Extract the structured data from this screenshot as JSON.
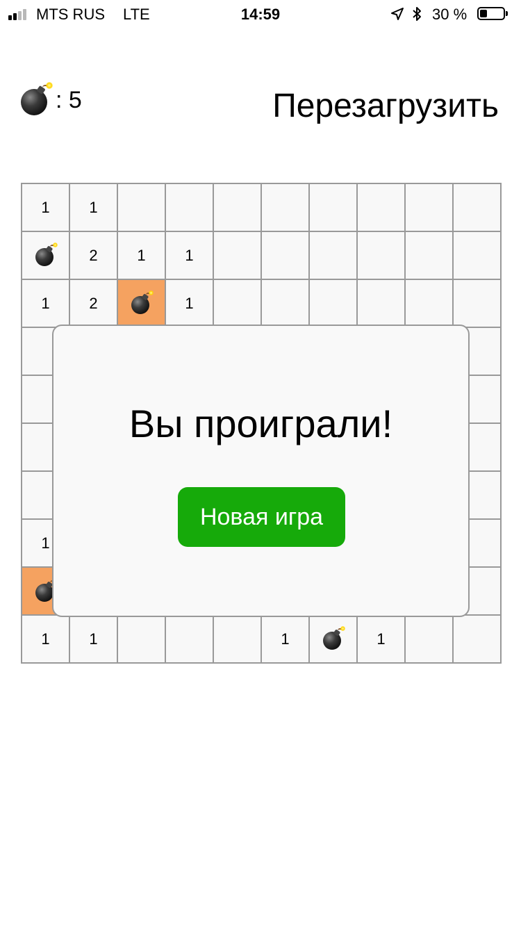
{
  "status_bar": {
    "carrier": "MTS RUS",
    "network": "LTE",
    "time": "14:59",
    "battery_text": "30 %",
    "battery_level": 0.3,
    "signal_bars_total": 4,
    "signal_bars_filled": 2,
    "icons": [
      "signal-icon",
      "location-arrow-icon",
      "bluetooth-icon",
      "battery-icon"
    ]
  },
  "header": {
    "mine_icon": "bomb-icon",
    "mine_count": ": 5",
    "reload_label": "Перезагрузить"
  },
  "board": {
    "rows": 10,
    "cols": 10,
    "cells": [
      [
        "1",
        "1",
        "",
        "",
        "",
        "",
        "",
        "",
        "",
        ""
      ],
      [
        "*",
        "2",
        "1",
        "1",
        "",
        "",
        "",
        "",
        "",
        ""
      ],
      [
        "1",
        "2",
        "*",
        "1",
        "",
        "",
        "",
        "",
        "",
        ""
      ],
      [
        "",
        "",
        "",
        "",
        "",
        "",
        "",
        "",
        "",
        ""
      ],
      [
        "",
        "",
        "",
        "",
        "",
        "",
        "",
        "",
        "",
        ""
      ],
      [
        "",
        "",
        "",
        "",
        "",
        "",
        "",
        "",
        "",
        ""
      ],
      [
        "",
        "",
        "",
        "",
        "",
        "",
        "",
        "",
        "",
        ""
      ],
      [
        "1",
        "",
        "",
        "",
        "",
        "",
        "",
        "",
        "",
        ""
      ],
      [
        "*",
        "",
        "",
        "",
        "",
        "",
        "",
        "",
        "",
        ""
      ],
      [
        "1",
        "1",
        "",
        "",
        "",
        "1",
        "*",
        "1",
        "",
        ""
      ]
    ],
    "exploded_cells": [
      [
        2,
        2
      ],
      [
        8,
        0
      ]
    ],
    "colors": {
      "cell_background": "#f8f8f8",
      "exploded_background": "#f5a260",
      "grid_line": "#999999"
    }
  },
  "dialog": {
    "title": "Вы проиграли!",
    "button_label": "Новая игра",
    "button_color": "#16aa0a"
  }
}
